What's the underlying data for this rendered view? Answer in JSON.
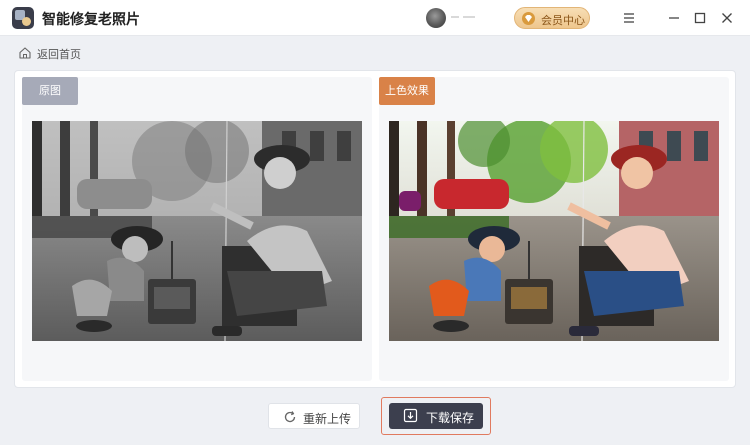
{
  "app": {
    "title": "智能修复老照片",
    "vip_label": "会员中心"
  },
  "nav": {
    "back_label": "返回首页"
  },
  "panels": {
    "original_label": "原图",
    "colorized_label": "上色效果"
  },
  "actions": {
    "reupload_label": "重新上传",
    "save_label": "下载保存"
  },
  "icons": {
    "logo": "app-logo-icon",
    "vip": "diamond-icon",
    "menu": "hamburger-icon",
    "minimize": "minimize-icon",
    "maximize": "maximize-icon",
    "close": "close-icon",
    "home": "home-icon",
    "reupload": "refresh-icon",
    "save": "download-icon"
  },
  "colors": {
    "original_tag": "#a6aab8",
    "colorized_tag": "#d98248",
    "save_button": "#3c3f4e",
    "save_outline": "#e07a5f",
    "vip_gold": "#eec68d"
  }
}
